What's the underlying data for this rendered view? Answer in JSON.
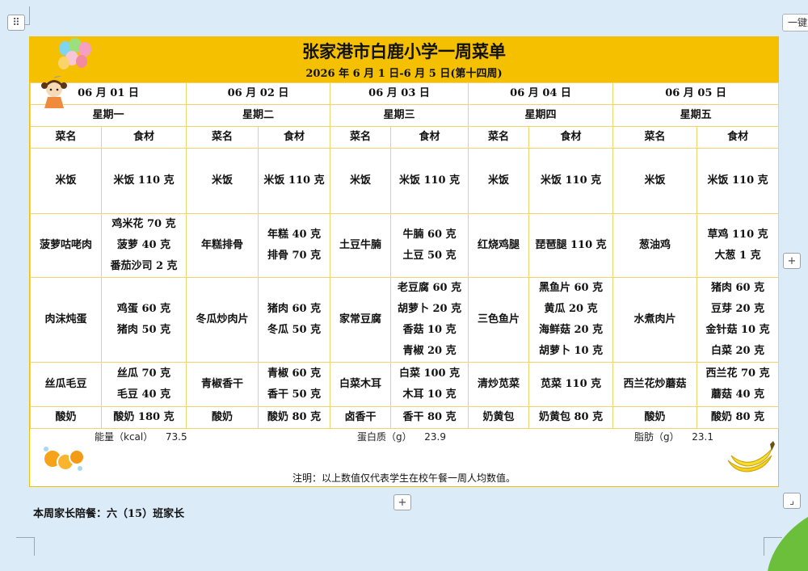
{
  "toolbar": {
    "right_button_label": "一键重"
  },
  "menu": {
    "title": "张家港市白鹿小学一周菜单",
    "subtitle": "2026 年 6 月 1 日-6 月 5 日(第十四周)",
    "days": [
      {
        "date": "06 月 01 日",
        "weekday": "星期一"
      },
      {
        "date": "06 月 02 日",
        "weekday": "星期二"
      },
      {
        "date": "06 月 03 日",
        "weekday": "星期三"
      },
      {
        "date": "06 月 04 日",
        "weekday": "星期四"
      },
      {
        "date": "06 月 05 日",
        "weekday": "星期五"
      }
    ],
    "col_dish": "菜名",
    "col_ingredient": "食材",
    "rows": [
      [
        {
          "dish": "米饭",
          "ingredients": [
            "米饭 110 克"
          ]
        },
        {
          "dish": "米饭",
          "ingredients": [
            "米饭 110 克"
          ]
        },
        {
          "dish": "米饭",
          "ingredients": [
            "米饭 110 克"
          ]
        },
        {
          "dish": "米饭",
          "ingredients": [
            "米饭 110 克"
          ]
        },
        {
          "dish": "米饭",
          "ingredients": [
            "米饭 110 克"
          ]
        }
      ],
      [
        {
          "dish": "菠萝咕咾肉",
          "ingredients": [
            "鸡米花 70 克",
            "菠萝 40 克",
            "番茄沙司 2 克"
          ]
        },
        {
          "dish": "年糕排骨",
          "ingredients": [
            "年糕 40 克",
            "排骨 70 克"
          ]
        },
        {
          "dish": "土豆牛腩",
          "ingredients": [
            "牛腩 60 克",
            "土豆 50 克"
          ]
        },
        {
          "dish": "红烧鸡腿",
          "ingredients": [
            "琵琶腿 110 克"
          ]
        },
        {
          "dish": "葱油鸡",
          "ingredients": [
            "草鸡 110 克",
            "大葱 1 克"
          ]
        }
      ],
      [
        {
          "dish": "肉沫炖蛋",
          "ingredients": [
            "鸡蛋 60 克",
            "猪肉 50 克"
          ]
        },
        {
          "dish": "冬瓜炒肉片",
          "ingredients": [
            "猪肉 60 克",
            "冬瓜 50 克"
          ]
        },
        {
          "dish": "家常豆腐",
          "ingredients": [
            "老豆腐 60 克",
            "胡萝卜 20 克",
            "香菇 10 克",
            "青椒 20 克"
          ]
        },
        {
          "dish": "三色鱼片",
          "ingredients": [
            "黑鱼片 60 克",
            "黄瓜 20 克",
            "海鲜菇 20 克",
            "胡萝卜 10 克"
          ]
        },
        {
          "dish": "水煮肉片",
          "ingredients": [
            "猪肉 60 克",
            "豆芽 20 克",
            "金针菇 10 克",
            "白菜 20 克"
          ]
        }
      ],
      [
        {
          "dish": "丝瓜毛豆",
          "ingredients": [
            "丝瓜 70 克",
            "毛豆 40 克"
          ]
        },
        {
          "dish": "青椒香干",
          "ingredients": [
            "青椒 60 克",
            "香干 50 克"
          ]
        },
        {
          "dish": "白菜木耳",
          "ingredients": [
            "白菜 100 克",
            "木耳 10 克"
          ]
        },
        {
          "dish": "清炒苋菜",
          "ingredients": [
            "苋菜 110 克"
          ]
        },
        {
          "dish": "西兰花炒蘑菇",
          "ingredients": [
            "西兰花 70 克",
            "蘑菇 40 克"
          ]
        }
      ],
      [
        {
          "dish": "酸奶",
          "ingredients": [
            "酸奶 180 克"
          ]
        },
        {
          "dish": "酸奶",
          "ingredients": [
            "酸奶 80 克"
          ]
        },
        {
          "dish": "卤香干",
          "ingredients": [
            "香干 80 克"
          ]
        },
        {
          "dish": "奶黄包",
          "ingredients": [
            "奶黄包 80 克"
          ]
        },
        {
          "dish": "酸奶",
          "ingredients": [
            "酸奶 80 克"
          ]
        }
      ]
    ],
    "nutrition": {
      "energy_label": "能量（kcal）",
      "energy_value": "73.5",
      "protein_label": "蛋白质（g）",
      "protein_value": "23.9",
      "fat_label": "脂肪（g）",
      "fat_value": "23.1"
    },
    "note": "注明：以上数值仅代表学生在校午餐一周人均数值。"
  },
  "below_text": "本周家长陪餐：六（15）班家长",
  "icons": {
    "move_handle": "move-handle-icon",
    "add": "plus-icon",
    "resize": "resize-icon"
  },
  "colors": {
    "header_bg": "#f4c000",
    "grid_line": "#f2d26a",
    "background": "#dcebf8"
  }
}
